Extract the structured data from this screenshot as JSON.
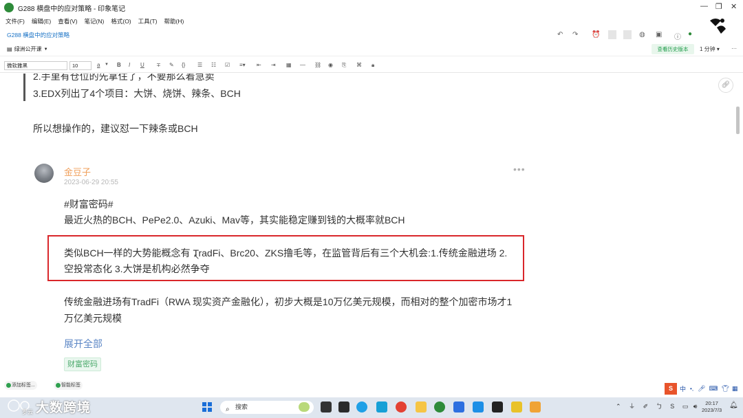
{
  "window": {
    "title": "G288  横盘中的应对策略 - 印象笔记",
    "minimize": "—",
    "restore": "❐",
    "close": "✕"
  },
  "menu": [
    "文件(F)",
    "编辑(E)",
    "查看(V)",
    "笔记(N)",
    "格式(O)",
    "工具(T)",
    "帮助(H)"
  ],
  "note_bar": {
    "title": "G288  横盘中的应对策略"
  },
  "share_bar": {
    "notebook": "绿洲公开课",
    "history_button": "查看历史版本",
    "read_time": "1 分钟"
  },
  "format_bar": {
    "font": "微软雅黑",
    "size": "10"
  },
  "content": {
    "line_quote_2": "2.手里有仓位的先拿住了，不要那么着急卖",
    "line_quote_3": "3.EDX列出了4个项目：大饼、烧饼、辣条、BCH",
    "line_suggest": "所以想操作的，建议怼一下辣条或BCH",
    "post": {
      "author": "金豆子",
      "date": "2023-06-29 20:55",
      "more": "•••",
      "hashtag": "#财富密码#",
      "line1": "最近火热的BCH、PePe2.0、Azuki、Mav等，其实能稳定赚到钱的大概率就BCH",
      "highlight_line1": "类似BCH一样的大势能概念有 TradFi、Brc20、ZKS撸毛等，在监管背后有三个大机会:1.传统金融进场  2.",
      "highlight_line2": "空投常态化  3.大饼是机构必然争夺",
      "line_tradfi1": "传统金融进场有TradFi（RWA 现实资产金融化），初步大概是10万亿美元规模，而相对的整个加密市场才1",
      "line_tradfi2": "万亿美元规模",
      "expand": "展开全部",
      "tag": "财富密码"
    }
  },
  "tag_bar": {
    "add_tag": "添加标签...",
    "smart_tag": "智能标签"
  },
  "ime": {
    "logo": "S",
    "lang": "中"
  },
  "taskbar": {
    "watermark": "大数跨境",
    "watermark_small": "岁云",
    "search_placeholder": "搜索",
    "time": "20:17",
    "date": "2023/7/3"
  },
  "colors": {
    "highlight_border": "#d9262a",
    "author": "#f0a05c",
    "link": "#5b86c5",
    "evernote_green": "#2e8b3a"
  }
}
